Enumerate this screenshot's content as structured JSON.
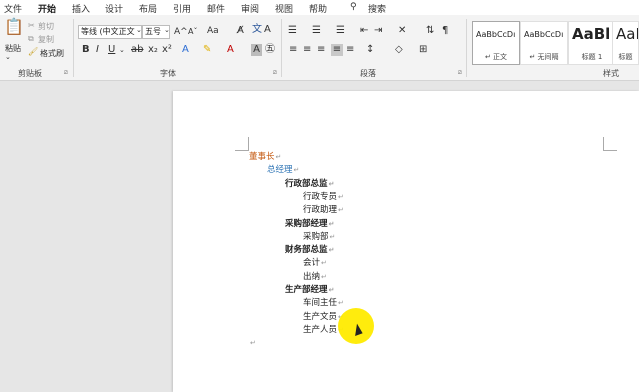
{
  "tabs": [
    "文件",
    "开始",
    "插入",
    "设计",
    "布局",
    "引用",
    "邮件",
    "审阅",
    "视图",
    "帮助"
  ],
  "search_label": "搜索",
  "clipboard": {
    "paste": "粘贴",
    "cut": "剪切",
    "copy": "复制",
    "format_painter": "格式刷",
    "label": "剪贴板"
  },
  "font": {
    "name": "等线 (中文正文",
    "size": "五号",
    "label": "字体"
  },
  "paragraph": {
    "label": "段落"
  },
  "styles": {
    "label": "样式",
    "items": [
      {
        "sample": "AaBbCcDı",
        "name": "↵ 正文"
      },
      {
        "sample": "AaBbCcDı",
        "name": "↵ 无间隔"
      },
      {
        "sample": "AaBl",
        "name": "标题 1"
      },
      {
        "sample": "AaB",
        "name": "标题"
      }
    ]
  },
  "document": {
    "pilcrow": "↵",
    "lines": [
      {
        "text": "董事长",
        "level": 0,
        "style": "orange"
      },
      {
        "text": "总经理",
        "level": 1,
        "style": "blue"
      },
      {
        "text": "行政部总监",
        "level": 2,
        "style": "bold"
      },
      {
        "text": "行政专员",
        "level": 3,
        "style": "normal"
      },
      {
        "text": "行政助理",
        "level": 3,
        "style": "normal"
      },
      {
        "text": "采购部经理",
        "level": 2,
        "style": "bold"
      },
      {
        "text": "采购部",
        "level": 3,
        "style": "normal"
      },
      {
        "text": "财务部总监",
        "level": 2,
        "style": "bold"
      },
      {
        "text": "会计",
        "level": 3,
        "style": "normal"
      },
      {
        "text": "出纳",
        "level": 3,
        "style": "normal"
      },
      {
        "text": "生产部经理",
        "level": 2,
        "style": "bold"
      },
      {
        "text": "车间主任",
        "level": 3,
        "style": "normal"
      },
      {
        "text": "生产文员",
        "level": 3,
        "style": "normal"
      },
      {
        "text": "生产人员",
        "level": 3,
        "style": "normal"
      },
      {
        "text": "",
        "level": 0,
        "style": "normal"
      }
    ]
  }
}
